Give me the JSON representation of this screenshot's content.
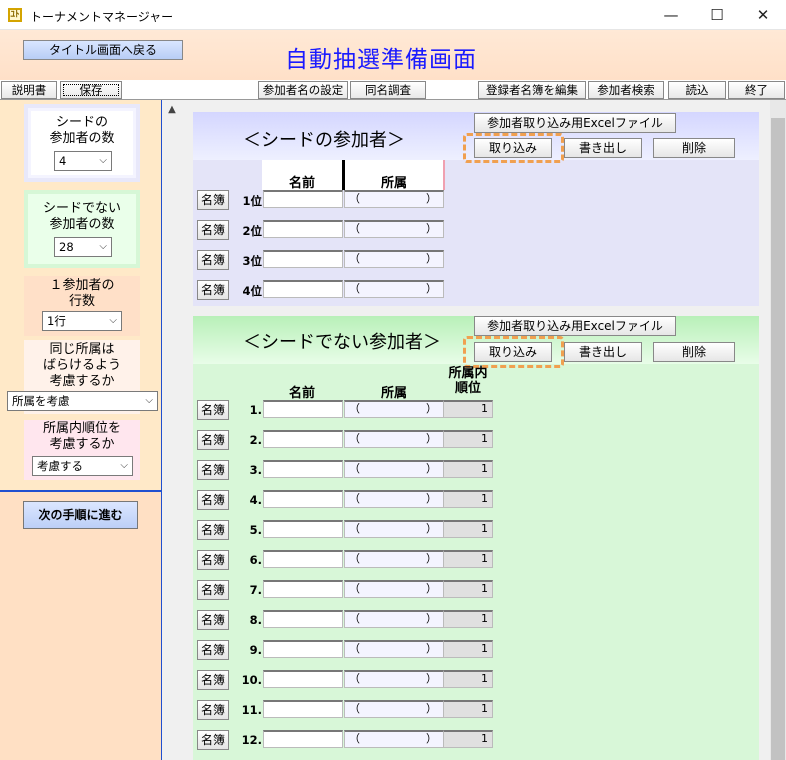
{
  "window": {
    "title": "トーナメントマネージャー",
    "icon": "app-icon",
    "icon_glyph": "ﾕﾄ",
    "minimize": "—",
    "maximize": "☐",
    "close": "✕"
  },
  "header": {
    "back_label": "タイトル画面へ戻る",
    "title": "自動抽選準備画面"
  },
  "toolbar": {
    "items": [
      "説明書",
      "保存",
      "参加者名の設定",
      "同名調査",
      "登録者名簿を編集",
      "参加者検索",
      "読込",
      "終了"
    ]
  },
  "left": {
    "seed_count_label": [
      "シードの",
      "参加者の数"
    ],
    "seed_count_value": "4",
    "nonseed_count_label": [
      "シードでない",
      "参加者の数"
    ],
    "nonseed_count_value": "28",
    "rows_label": [
      "１参加者の",
      "行数"
    ],
    "rows_value": "1行",
    "spread_label": [
      "同じ所属は",
      "ばらけるよう",
      "考慮するか"
    ],
    "spread_value": "所属を考慮",
    "rank_label": [
      "所属内順位を",
      "考慮するか"
    ],
    "rank_value": "考慮する",
    "next_label": "次の手順に進む",
    "dropdown_arrow": "⌵"
  },
  "seed": {
    "title": "＜シードの参加者＞",
    "excel_label": "参加者取り込み用Excelファイル",
    "import_label": "取り込み",
    "export_label": "書き出し",
    "delete_label": "削除",
    "col_name": "名前",
    "col_aff": "所属",
    "row_button": "名簿",
    "rows": [
      "1位",
      "2位",
      "3位",
      "4位"
    ]
  },
  "nonseed": {
    "title": "＜シードでない参加者＞",
    "excel_label": "参加者取り込み用Excelファイル",
    "import_label": "取り込み",
    "export_label": "書き出し",
    "delete_label": "削除",
    "col_name": "名前",
    "col_aff": "所属",
    "col_rank": [
      "所属内",
      "順位"
    ],
    "row_button": "名簿",
    "rows": [
      {
        "label": "1.",
        "rank": "1"
      },
      {
        "label": "2.",
        "rank": "1"
      },
      {
        "label": "3.",
        "rank": "1"
      },
      {
        "label": "4.",
        "rank": "1"
      },
      {
        "label": "5.",
        "rank": "1"
      },
      {
        "label": "6.",
        "rank": "1"
      },
      {
        "label": "7.",
        "rank": "1"
      },
      {
        "label": "8.",
        "rank": "1"
      },
      {
        "label": "9.",
        "rank": "1"
      },
      {
        "label": "10.",
        "rank": "1"
      },
      {
        "label": "11.",
        "rank": "1"
      },
      {
        "label": "12.",
        "rank": "1"
      }
    ]
  },
  "paren_open": "（",
  "paren_close": "）"
}
